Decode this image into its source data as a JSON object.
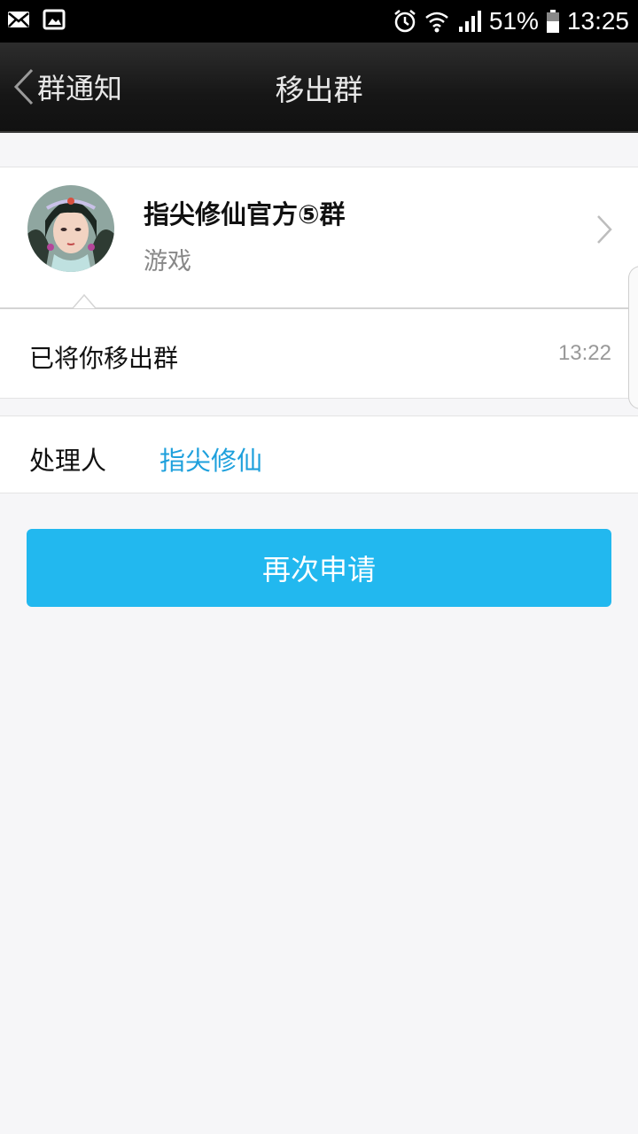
{
  "status_bar": {
    "left_icons": [
      "mail-icon",
      "image-icon"
    ],
    "right_icons": [
      "alarm-icon",
      "wifi-icon",
      "signal-icon",
      "battery-icon"
    ],
    "battery": "51%",
    "time": "13:25"
  },
  "nav": {
    "back_label": "群通知",
    "title": "移出群"
  },
  "group": {
    "name": "指尖修仙官方⑤群",
    "category": "游戏"
  },
  "notice": {
    "message": "已将你移出群",
    "time": "13:22"
  },
  "handler": {
    "label": "处理人",
    "name": "指尖修仙"
  },
  "actions": {
    "reapply_label": "再次申请"
  },
  "colors": {
    "accent": "#22b8ef",
    "link": "#1ea0dc",
    "background": "#f6f6f8"
  }
}
